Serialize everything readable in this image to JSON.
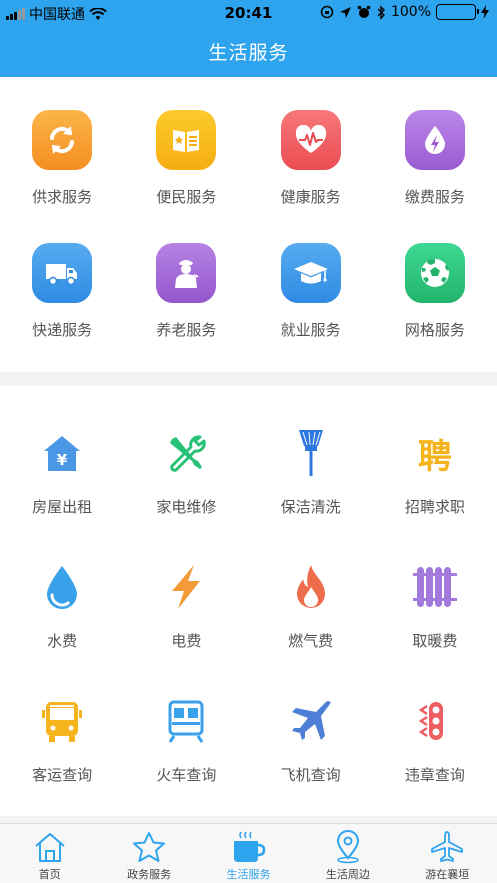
{
  "status_bar": {
    "carrier": "中国联通",
    "time": "20:41",
    "battery": "100%"
  },
  "nav": {
    "title": "生活服务"
  },
  "services_top": [
    {
      "label": "供求服务",
      "icon": "refresh-arrows-icon",
      "color": "#f7a233"
    },
    {
      "label": "便民服务",
      "icon": "book-star-icon",
      "color": "#f6bb1a"
    },
    {
      "label": "健康服务",
      "icon": "heartbeat-icon",
      "color": "#ee5e61"
    },
    {
      "label": "缴费服务",
      "icon": "water-drop-bolt-icon",
      "color": "#a76ed9"
    },
    {
      "label": "快递服务",
      "icon": "truck-icon",
      "color": "#3d99e8"
    },
    {
      "label": "养老服务",
      "icon": "elderly-person-icon",
      "color": "#a56bd6"
    },
    {
      "label": "就业服务",
      "icon": "graduation-cap-icon",
      "color": "#3d99e8"
    },
    {
      "label": "网格服务",
      "icon": "soccer-ball-icon",
      "color": "#2fc57e"
    }
  ],
  "services_bottom": [
    {
      "label": "房屋出租",
      "icon": "house-yen-icon",
      "color": "#4a97e6"
    },
    {
      "label": "家电维修",
      "icon": "wrench-screwdriver-icon",
      "color": "#27c178"
    },
    {
      "label": "保洁清洗",
      "icon": "broom-icon",
      "color": "#2c78e0"
    },
    {
      "label": "招聘求职",
      "icon": "recruit-character-icon",
      "color": "#f5b31c",
      "glyph": "聘"
    },
    {
      "label": "水费",
      "icon": "water-drop-icon",
      "color": "#3aa2ea"
    },
    {
      "label": "电费",
      "icon": "lightning-bolt-icon",
      "color": "#f29a38"
    },
    {
      "label": "燃气费",
      "icon": "flame-icon",
      "color": "#ee6d4c"
    },
    {
      "label": "取暖费",
      "icon": "radiator-icon",
      "color": "#a479dc"
    },
    {
      "label": "客运查询",
      "icon": "bus-icon",
      "color": "#f5b31c"
    },
    {
      "label": "火车查询",
      "icon": "train-icon",
      "color": "#3aa2ea"
    },
    {
      "label": "飞机查询",
      "icon": "airplane-icon",
      "color": "#4d7fd6"
    },
    {
      "label": "违章查询",
      "icon": "traffic-light-icon",
      "color": "#ee5e61"
    }
  ],
  "tabbar": [
    {
      "label": "首页",
      "icon": "home-icon",
      "active": false
    },
    {
      "label": "政务服务",
      "icon": "star-icon",
      "active": false
    },
    {
      "label": "生活服务",
      "icon": "coffee-cup-icon",
      "active": true
    },
    {
      "label": "生活周边",
      "icon": "location-pin-icon",
      "active": false
    },
    {
      "label": "游在襄垣",
      "icon": "airplane-icon",
      "active": false
    }
  ],
  "colors": {
    "nav_blue": "#2ea3ee",
    "tab_active": "#2ea3ee"
  }
}
